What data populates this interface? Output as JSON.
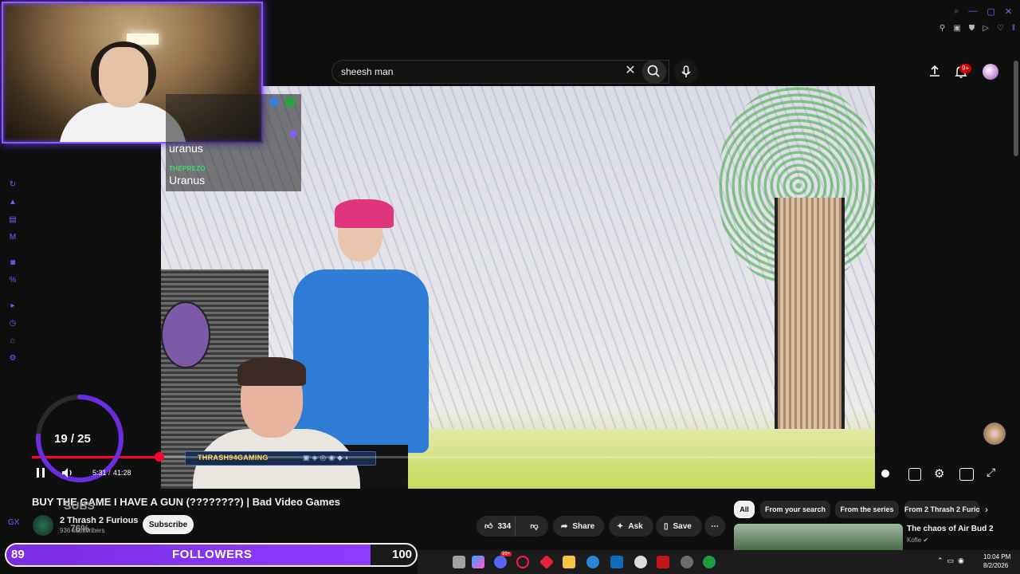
{
  "search": {
    "query": "sheesh man"
  },
  "header": {
    "notification_count": "9+"
  },
  "chat": {
    "messages": [
      {
        "user": "",
        "text": "uranus",
        "color": "#ffffff"
      },
      {
        "user": "THEPREZO",
        "text": "Uranus",
        "color": "#3cd96b"
      }
    ]
  },
  "stream_overlay": {
    "nameplate": "THRASH94GAMING",
    "subs_goal": {
      "count": "19 / 25",
      "label": "SUBS",
      "percent_text": "76%",
      "fraction": 0.76
    },
    "followers_goal": {
      "current": "89",
      "label": "FOLLOWERS",
      "goal": "100",
      "fraction": 0.89
    }
  },
  "player": {
    "time_current": "5:31",
    "time_separator": "/",
    "time_total": "41:28",
    "progress_fraction": 0.1517,
    "accent_color": "#ff0033"
  },
  "video": {
    "title": "BUY THE GAME I HAVE A GUN (????????) | Bad Video Games",
    "channel_name": "2 Thrash 2 Furious",
    "channel_subs": "936 subscribers",
    "subscribe_label": "Subscribe"
  },
  "actions": {
    "like_count": "334",
    "share_label": "Share",
    "ask_label": "Ask",
    "save_label": "Save"
  },
  "filters": {
    "chips": [
      "All",
      "From your search",
      "From the series",
      "From 2 Thrash 2 Furious"
    ]
  },
  "recommendation": {
    "title": "The chaos of Air Bud 2",
    "channel": "Kofie"
  },
  "taskbar": {
    "time": "10:04 PM",
    "date": "8/2/2026",
    "discord_badge": "99+"
  }
}
